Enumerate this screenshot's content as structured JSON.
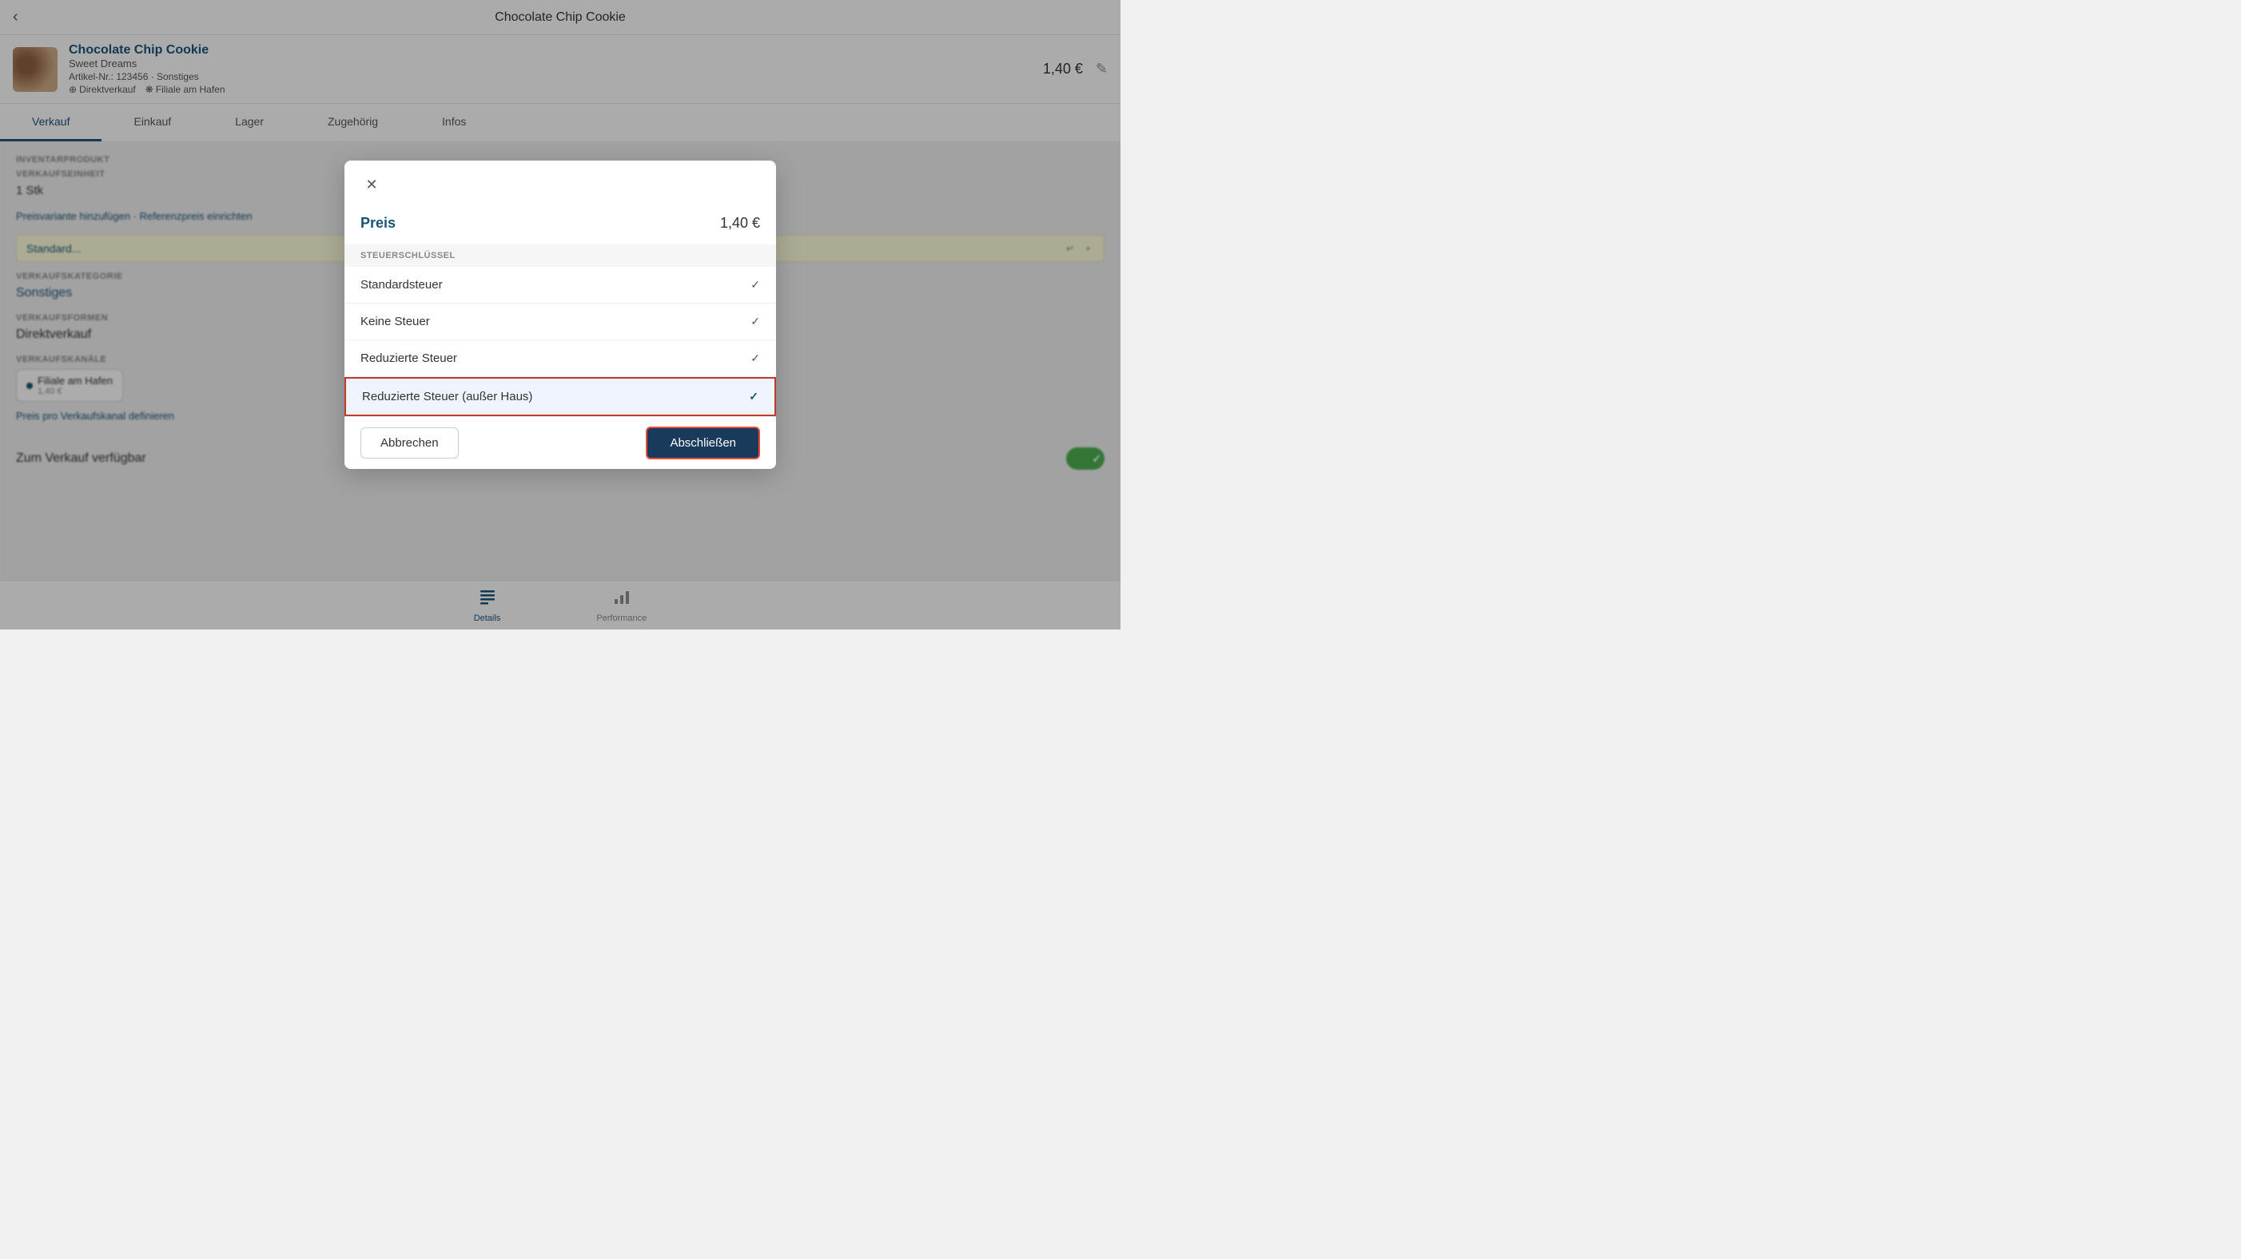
{
  "topBar": {
    "title": "Chocolate Chip Cookie",
    "backLabel": "‹"
  },
  "productHeader": {
    "name": "Chocolate Chip Cookie",
    "subtitle": "Sweet Dreams",
    "articleInfo": "Artikel-Nr.: 123456 · Sonstiges",
    "tags": [
      "Direktverkauf",
      "Filiale am Hafen"
    ],
    "price": "1,40 €"
  },
  "tabs": [
    {
      "label": "Verkauf",
      "active": true
    },
    {
      "label": "Einkauf",
      "active": false
    },
    {
      "label": "Lager",
      "active": false
    },
    {
      "label": "Zugehörig",
      "active": false
    },
    {
      "label": "Infos",
      "active": false
    }
  ],
  "mainContent": {
    "inventarLabel": "INVENTARPRODUKT",
    "verkaufseinheitLabel": "VERKAUFSEINHEIT",
    "verkaufseinheitValue": "1 Stk",
    "preisvariante": "Preisvariante hinzufügen · Referenzpreis einrichten",
    "verkaufskategorieLabel": "VERKAUFSKATEGORIE",
    "verkaufskategorieValue": "Sonstiges",
    "verkaufsformenLabel": "VERKAUFSFORMEN",
    "verkaufsformenValue": "Direktverkauf",
    "verkaufskanäleLabel": "VERKAUFSKANÄLE",
    "channelName": "Filiale am Hafen",
    "channelPrice": "1,40 €",
    "preisLink": "Preis pro Verkaufskanal definieren",
    "standardLabel": "Standard...",
    "verfügbarLabel": "Zum Verkauf verfügbar"
  },
  "modal": {
    "closeIcon": "✕",
    "priceLabel": "Preis",
    "priceValue": "1,40 €",
    "sectionLabel": "STEUERSCHLÜSSEL",
    "taxOptions": [
      {
        "label": "Standardsteuer",
        "selected": false,
        "hasCheck": true
      },
      {
        "label": "Keine Steuer",
        "selected": false,
        "hasCheck": true
      },
      {
        "label": "Reduzierte Steuer",
        "selected": false,
        "hasCheck": true
      },
      {
        "label": "Reduzierte Steuer (außer Haus)",
        "selected": true,
        "hasCheck": true
      }
    ],
    "cancelLabel": "Abbrechen",
    "confirmLabel": "Abschließen"
  },
  "bottomNav": [
    {
      "label": "Details",
      "icon": "☰",
      "active": true
    },
    {
      "label": "Performance",
      "icon": "📊",
      "active": false
    }
  ]
}
